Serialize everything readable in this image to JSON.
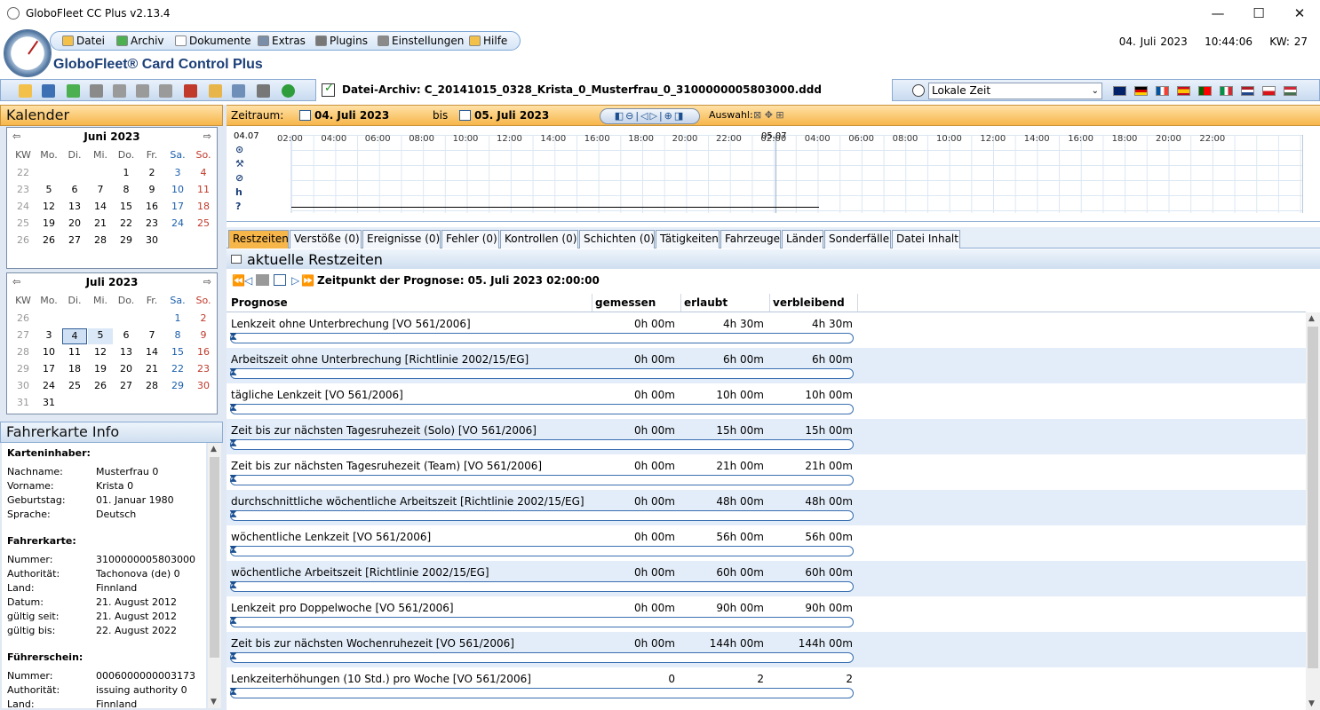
{
  "window": {
    "title": "GloboFleet CC Plus v2.13.4",
    "minimize": "—",
    "maximize": "☐",
    "close": "✕"
  },
  "menu": {
    "items": [
      "Datei",
      "Archiv",
      "Dokumente",
      "Extras",
      "Plugins",
      "Einstellungen",
      "Hilfe"
    ],
    "date": "04. Juli 2023",
    "time": "10:44:06",
    "kw": "KW: 27"
  },
  "app": {
    "title": "GloboFleet® Card Control Plus"
  },
  "archive": {
    "label": "Datei-Archiv: C_20141015_0328_Krista_0_Musterfrau_0_3100000005803000.ddd"
  },
  "timezone": {
    "selected": "Lokale Zeit"
  },
  "calendar": {
    "title": "Kalender",
    "weekday_headers": [
      "KW",
      "Mo.",
      "Di.",
      "Mi.",
      "Do.",
      "Fr.",
      "Sa.",
      "So."
    ],
    "months": [
      {
        "name": "Juni 2023",
        "weeks": [
          [
            "22",
            "",
            "",
            "",
            "1",
            "2",
            "3",
            "4"
          ],
          [
            "23",
            "5",
            "6",
            "7",
            "8",
            "9",
            "10",
            "11"
          ],
          [
            "24",
            "12",
            "13",
            "14",
            "15",
            "16",
            "17",
            "18"
          ],
          [
            "25",
            "19",
            "20",
            "21",
            "22",
            "23",
            "24",
            "25"
          ],
          [
            "26",
            "26",
            "27",
            "28",
            "29",
            "30",
            "",
            ""
          ]
        ]
      },
      {
        "name": "Juli 2023",
        "weeks": [
          [
            "26",
            "",
            "",
            "",
            "",
            "",
            "1",
            "2"
          ],
          [
            "27",
            "3",
            "4",
            "5",
            "6",
            "7",
            "8",
            "9"
          ],
          [
            "28",
            "10",
            "11",
            "12",
            "13",
            "14",
            "15",
            "16"
          ],
          [
            "29",
            "17",
            "18",
            "19",
            "20",
            "21",
            "22",
            "23"
          ],
          [
            "30",
            "24",
            "25",
            "26",
            "27",
            "28",
            "29",
            "30"
          ],
          [
            "31",
            "31",
            "",
            "",
            "",
            "",
            "",
            ""
          ]
        ],
        "selected_day": "4",
        "highlight_day": "5"
      }
    ]
  },
  "fahrerkarte": {
    "title": "Fahrerkarte Info",
    "sections": [
      {
        "heading": "Karteninhaber:",
        "rows": [
          {
            "label": "Nachname:",
            "value": "Musterfrau 0"
          },
          {
            "label": "Vorname:",
            "value": "Krista 0"
          },
          {
            "label": "Geburtstag:",
            "value": "01. Januar 1980"
          },
          {
            "label": "Sprache:",
            "value": "Deutsch"
          }
        ]
      },
      {
        "heading": "Fahrerkarte:",
        "rows": [
          {
            "label": "Nummer:",
            "value": "3100000005803000"
          },
          {
            "label": "Authorität:",
            "value": "Tachonova (de) 0"
          },
          {
            "label": "Land:",
            "value": "Finnland"
          },
          {
            "label": "Datum:",
            "value": "21. August 2012"
          },
          {
            "label": "gültig seit:",
            "value": "21. August 2012"
          },
          {
            "label": "gültig bis:",
            "value": "22. August 2022"
          }
        ]
      },
      {
        "heading": "Führerschein:",
        "rows": [
          {
            "label": "Nummer:",
            "value": "0006000000003173"
          },
          {
            "label": "Authorität:",
            "value": "issuing authority 0"
          },
          {
            "label": "Land:",
            "value": "Finnland"
          }
        ]
      }
    ]
  },
  "zeitraum": {
    "label": "Zeitraum:",
    "from": "04. Juli 2023",
    "to_label": "bis",
    "to": "05. Juli 2023",
    "auswahl": "Auswahl:"
  },
  "timeline": {
    "day1": "04.07",
    "day2": "05.07",
    "hours": [
      "02:00",
      "04:00",
      "06:00",
      "08:00",
      "10:00",
      "12:00",
      "14:00",
      "16:00",
      "18:00",
      "20:00",
      "22:00",
      "02:00",
      "04:00",
      "06:00",
      "08:00",
      "10:00",
      "12:00",
      "14:00",
      "16:00",
      "18:00",
      "20:00",
      "22:00"
    ],
    "row_icons": [
      "⊙",
      "⚒",
      "⊘",
      "h",
      "?"
    ]
  },
  "tabs": [
    "Restzeiten",
    "Verstöße (0)",
    "Ereignisse (0)",
    "Fehler (0)",
    "Kontrollen (0)",
    "Schichten (0)",
    "Tätigkeiten",
    "Fahrzeuge",
    "Länder",
    "Sonderfälle",
    "Datei Inhalt"
  ],
  "section": {
    "title": "aktuelle Restzeiten",
    "prognose": "Zeitpunkt der Prognose: 05. Juli 2023 02:00:00"
  },
  "table": {
    "headers": [
      "Prognose",
      "gemessen",
      "erlaubt",
      "verbleibend"
    ],
    "rows": [
      {
        "name": "Lenkzeit ohne Unterbrechung [VO 561/2006]",
        "gemessen": "0h 00m",
        "erlaubt": "4h 30m",
        "verbleibend": "4h 30m"
      },
      {
        "name": "Arbeitszeit ohne Unterbrechung [Richtlinie 2002/15/EG]",
        "gemessen": "0h 00m",
        "erlaubt": "6h 00m",
        "verbleibend": "6h 00m"
      },
      {
        "name": "tägliche Lenkzeit [VO 561/2006]",
        "gemessen": "0h 00m",
        "erlaubt": "10h 00m",
        "verbleibend": "10h 00m"
      },
      {
        "name": "Zeit bis zur nächsten Tagesruhezeit (Solo) [VO 561/2006]",
        "gemessen": "0h 00m",
        "erlaubt": "15h 00m",
        "verbleibend": "15h 00m"
      },
      {
        "name": "Zeit bis zur nächsten Tagesruhezeit (Team) [VO 561/2006]",
        "gemessen": "0h 00m",
        "erlaubt": "21h 00m",
        "verbleibend": "21h 00m"
      },
      {
        "name": "durchschnittliche wöchentliche Arbeitszeit [Richtlinie 2002/15/EG]",
        "gemessen": "0h 00m",
        "erlaubt": "48h 00m",
        "verbleibend": "48h 00m"
      },
      {
        "name": "wöchentliche Lenkzeit [VO 561/2006]",
        "gemessen": "0h 00m",
        "erlaubt": "56h 00m",
        "verbleibend": "56h 00m"
      },
      {
        "name": "wöchentliche Arbeitszeit [Richtlinie 2002/15/EG]",
        "gemessen": "0h 00m",
        "erlaubt": "60h 00m",
        "verbleibend": "60h 00m"
      },
      {
        "name": "Lenkzeit pro Doppelwoche [VO 561/2006]",
        "gemessen": "0h 00m",
        "erlaubt": "90h 00m",
        "verbleibend": "90h 00m"
      },
      {
        "name": "Zeit bis zur nächsten Wochenruhezeit [VO 561/2006]",
        "gemessen": "0h 00m",
        "erlaubt": "144h 00m",
        "verbleibend": "144h 00m"
      },
      {
        "name": "Lenkzeiterhöhungen (10 Std.) pro Woche [VO 561/2006]",
        "gemessen": "0",
        "erlaubt": "2",
        "verbleibend": "2"
      }
    ]
  }
}
